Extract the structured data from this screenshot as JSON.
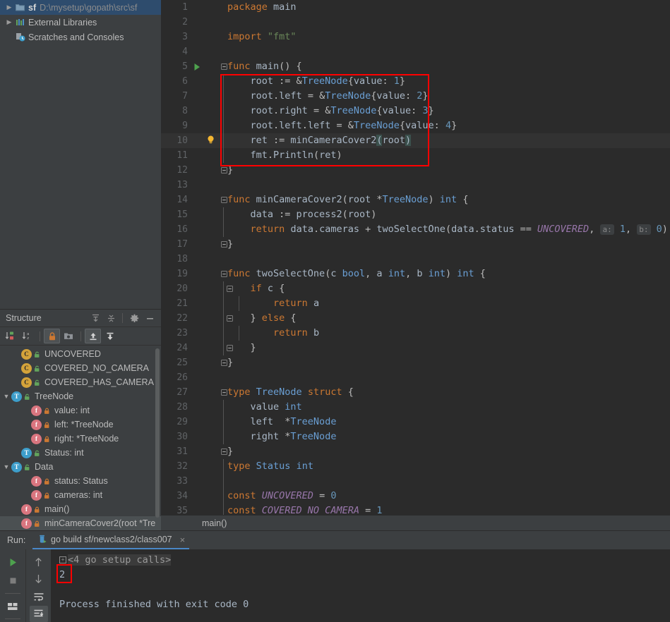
{
  "project_tree": {
    "items": [
      {
        "arrow": "chevron-right",
        "icon": "folder-module",
        "module": "sf",
        "label": "D:\\mysetup\\gopath\\src\\sf",
        "selected": true
      },
      {
        "arrow": "chevron-right",
        "icon": "external-libraries",
        "module": "",
        "label": "External Libraries",
        "selected": false
      },
      {
        "arrow": "",
        "icon": "scratches",
        "module": "",
        "label": "Scratches and Consoles",
        "selected": false
      }
    ]
  },
  "structure": {
    "title": "Structure",
    "header_icons": [
      "expand-all-icon",
      "collapse-all-icon",
      "gear-icon",
      "hide-icon"
    ],
    "toolbar_icons": [
      {
        "name": "sort-by-visibility-icon",
        "active": false
      },
      {
        "name": "sort-alphabetically-icon",
        "active": false
      },
      {
        "name": "show-non-public-icon",
        "active": true
      },
      {
        "name": "group-by-folder-icon",
        "active": false
      },
      {
        "name": "scroll-from-source-icon",
        "active": true
      },
      {
        "name": "scroll-to-source-icon",
        "active": false
      }
    ],
    "items": [
      {
        "indent": 1,
        "arrow": "",
        "badge": "c",
        "badge_letter": "C",
        "lock": "public",
        "label": "UNCOVERED",
        "highlighted": false
      },
      {
        "indent": 1,
        "arrow": "",
        "badge": "c",
        "badge_letter": "C",
        "lock": "public",
        "label": "COVERED_NO_CAMERA",
        "highlighted": false
      },
      {
        "indent": 1,
        "arrow": "",
        "badge": "c",
        "badge_letter": "C",
        "lock": "public",
        "label": "COVERED_HAS_CAMERA",
        "highlighted": false
      },
      {
        "indent": 0,
        "arrow": "chevron-down",
        "badge": "t",
        "badge_letter": "T",
        "lock": "public",
        "label": "TreeNode",
        "highlighted": false
      },
      {
        "indent": 2,
        "arrow": "",
        "badge": "f",
        "badge_letter": "f",
        "lock": "private",
        "label": "value: int",
        "highlighted": false
      },
      {
        "indent": 2,
        "arrow": "",
        "badge": "f",
        "badge_letter": "f",
        "lock": "private",
        "label": "left: *TreeNode",
        "highlighted": false
      },
      {
        "indent": 2,
        "arrow": "",
        "badge": "f",
        "badge_letter": "f",
        "lock": "private",
        "label": "right: *TreeNode",
        "highlighted": false
      },
      {
        "indent": 1,
        "arrow": "",
        "badge": "t",
        "badge_letter": "T",
        "lock": "public",
        "label": "Status: int",
        "highlighted": false
      },
      {
        "indent": 0,
        "arrow": "chevron-down",
        "badge": "t",
        "badge_letter": "T",
        "lock": "public",
        "label": "Data",
        "highlighted": false
      },
      {
        "indent": 2,
        "arrow": "",
        "badge": "f",
        "badge_letter": "f",
        "lock": "private",
        "label": "status: Status",
        "highlighted": false
      },
      {
        "indent": 2,
        "arrow": "",
        "badge": "f",
        "badge_letter": "f",
        "lock": "private",
        "label": "cameras: int",
        "highlighted": false
      },
      {
        "indent": 1,
        "arrow": "",
        "badge": "f",
        "badge_letter": "f",
        "lock": "private",
        "label": "main()",
        "highlighted": false
      },
      {
        "indent": 1,
        "arrow": "",
        "badge": "f",
        "badge_letter": "f",
        "lock": "private",
        "label": "minCameraCover2(root *Tre",
        "highlighted": true
      }
    ]
  },
  "editor": {
    "breadcrumb": "main()",
    "current_line": 10,
    "lines": [
      {
        "n": 1,
        "fold": "",
        "gutter": "",
        "indent": 0
      },
      {
        "n": 2,
        "fold": "",
        "gutter": "",
        "indent": 0
      },
      {
        "n": 3,
        "fold": "",
        "gutter": "",
        "indent": 0
      },
      {
        "n": 4,
        "fold": "",
        "gutter": "",
        "indent": 0
      },
      {
        "n": 5,
        "fold": "open",
        "gutter": "run",
        "indent": 0
      },
      {
        "n": 6,
        "fold": "",
        "gutter": "",
        "indent": 1
      },
      {
        "n": 7,
        "fold": "",
        "gutter": "",
        "indent": 1
      },
      {
        "n": 8,
        "fold": "",
        "gutter": "",
        "indent": 1
      },
      {
        "n": 9,
        "fold": "",
        "gutter": "",
        "indent": 1
      },
      {
        "n": 10,
        "fold": "",
        "gutter": "bulb",
        "indent": 1
      },
      {
        "n": 11,
        "fold": "",
        "gutter": "",
        "indent": 1
      },
      {
        "n": 12,
        "fold": "close",
        "gutter": "",
        "indent": 0
      },
      {
        "n": 13,
        "fold": "",
        "gutter": "",
        "indent": 0
      },
      {
        "n": 14,
        "fold": "open",
        "gutter": "",
        "indent": 0
      },
      {
        "n": 15,
        "fold": "",
        "gutter": "",
        "indent": 1
      },
      {
        "n": 16,
        "fold": "",
        "gutter": "",
        "indent": 1
      },
      {
        "n": 17,
        "fold": "close",
        "gutter": "",
        "indent": 0
      },
      {
        "n": 18,
        "fold": "",
        "gutter": "",
        "indent": 0
      },
      {
        "n": 19,
        "fold": "open",
        "gutter": "",
        "indent": 0
      },
      {
        "n": 20,
        "fold": "open2",
        "gutter": "",
        "indent": 1
      },
      {
        "n": 21,
        "fold": "",
        "gutter": "",
        "indent": 2
      },
      {
        "n": 22,
        "fold": "close2",
        "gutter": "",
        "indent": 1
      },
      {
        "n": 23,
        "fold": "",
        "gutter": "",
        "indent": 2
      },
      {
        "n": 24,
        "fold": "close2",
        "gutter": "",
        "indent": 1
      },
      {
        "n": 25,
        "fold": "close",
        "gutter": "",
        "indent": 0
      },
      {
        "n": 26,
        "fold": "",
        "gutter": "",
        "indent": 0
      },
      {
        "n": 27,
        "fold": "open",
        "gutter": "",
        "indent": 0
      },
      {
        "n": 28,
        "fold": "",
        "gutter": "",
        "indent": 1
      },
      {
        "n": 29,
        "fold": "",
        "gutter": "",
        "indent": 1
      },
      {
        "n": 30,
        "fold": "",
        "gutter": "",
        "indent": 1
      },
      {
        "n": 31,
        "fold": "close",
        "gutter": "",
        "indent": 0
      },
      {
        "n": 32,
        "fold": "",
        "gutter": "",
        "indent": 0
      },
      {
        "n": 33,
        "fold": "",
        "gutter": "",
        "indent": 0
      },
      {
        "n": 34,
        "fold": "",
        "gutter": "",
        "indent": 0
      },
      {
        "n": 35,
        "fold": "",
        "gutter": "",
        "indent": 0
      }
    ],
    "code_text": [
      "package main",
      "",
      "import \"fmt\"",
      "",
      "func main() {",
      "    root := &TreeNode{value: 1}",
      "    root.left = &TreeNode{value: 2}",
      "    root.right = &TreeNode{value: 3}",
      "    root.left.left = &TreeNode{value: 4}",
      "    ret := minCameraCover2(root)",
      "    fmt.Println(ret)",
      "}",
      "",
      "func minCameraCover2(root *TreeNode) int {",
      "    data := process2(root)",
      "    return data.cameras + twoSelectOne(data.status == UNCOVERED, a: 1, b: 0)",
      "}",
      "",
      "func twoSelectOne(c bool, a int, b int) int {",
      "    if c {",
      "        return a",
      "    } else {",
      "        return b",
      "    }",
      "}",
      "",
      "type TreeNode struct {",
      "    value int",
      "    left  *TreeNode",
      "    right *TreeNode",
      "}",
      "type Status int",
      "",
      "const UNCOVERED = 0",
      "const COVERED_NO_CAMERA = 1"
    ],
    "inlay_hints": {
      "a": "a:",
      "a_value": "1",
      "b": "b:",
      "b_value": "0"
    }
  },
  "run_panel": {
    "label": "Run:",
    "tab": {
      "icon": "run-config-icon",
      "title": "go build sf/newclass2/class007",
      "close": "×"
    },
    "left_buttons": [
      {
        "name": "rerun-button",
        "icon": "play-icon"
      },
      {
        "name": "stop-button",
        "icon": "stop-icon"
      },
      {
        "name": "layout-button",
        "icon": "layout-icon"
      }
    ],
    "second_buttons": [
      {
        "name": "up-button",
        "icon": "arrow-up-icon"
      },
      {
        "name": "down-button",
        "icon": "arrow-down-icon"
      },
      {
        "name": "soft-wrap-button",
        "icon": "wrap-icon"
      },
      {
        "name": "scroll-to-end-button",
        "icon": "scroll-end-icon",
        "active": true
      }
    ],
    "console": {
      "setup_calls": "<4 go setup calls>",
      "output": "2",
      "finished": "Process finished with exit code 0"
    }
  },
  "annotations": {
    "code_box": {
      "color": "#ff0000"
    },
    "output_box": {
      "color": "#ff0000"
    }
  },
  "colors": {
    "editor_bg": "#2b2b2b",
    "panel_bg": "#3c3f41",
    "selection": "#2e4c6d",
    "accent": "#ff0000",
    "tab_underline": "#4a88c7"
  }
}
